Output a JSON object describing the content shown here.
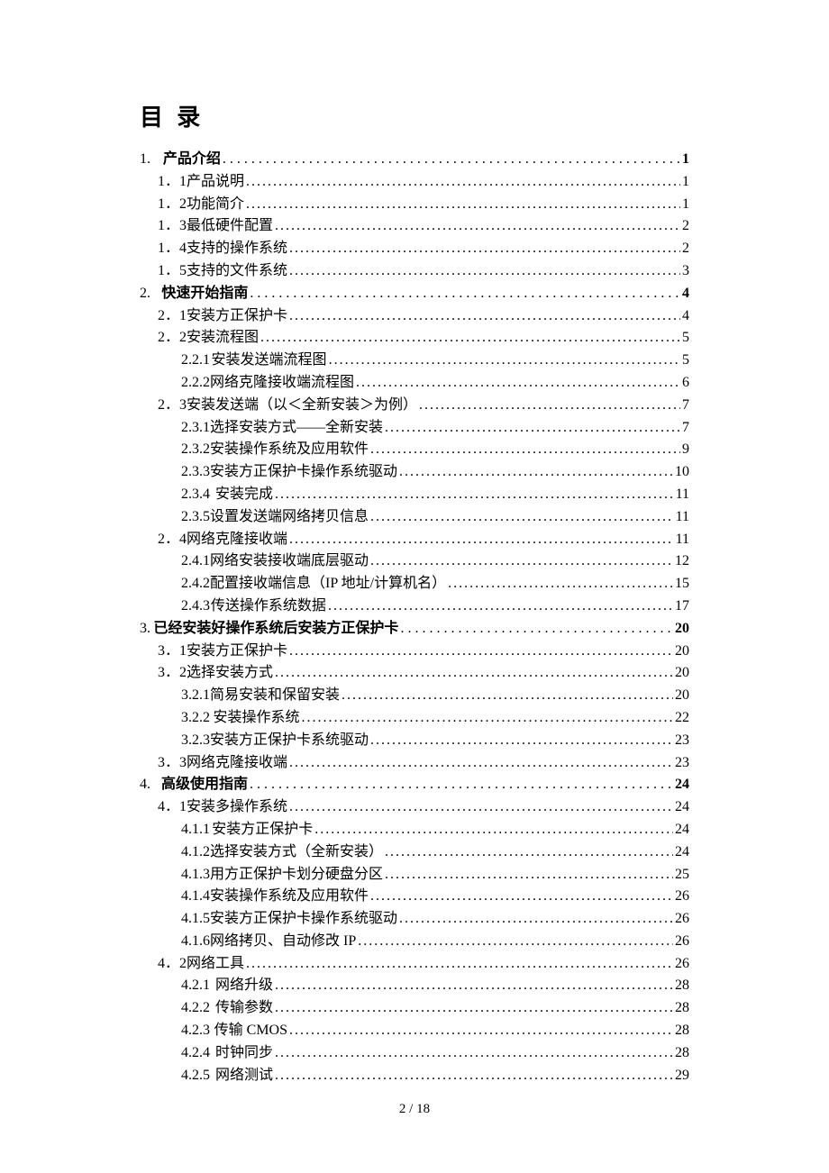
{
  "toc_heading": "目  录",
  "footer": "2  /  18",
  "entries": [
    {
      "level": 1,
      "num": "1.",
      "title": "产品介绍",
      "page": "1",
      "bold": true
    },
    {
      "level": 2,
      "num": "1．1",
      "title": "产品说明",
      "page": "1"
    },
    {
      "level": 2,
      "num": "1．2",
      "title": "功能简介",
      "page": "1"
    },
    {
      "level": 2,
      "num": "1．3",
      "title": "最低硬件配置",
      "page": "2"
    },
    {
      "level": 2,
      "num": "1．4",
      "title": "支持的操作系统",
      "page": "2"
    },
    {
      "level": 2,
      "num": "1．5",
      "title": "支持的文件系统",
      "page": "3"
    },
    {
      "level": 1,
      "num": "2.",
      "title": "快速开始指南",
      "page": "4",
      "bold": true
    },
    {
      "level": 2,
      "num": "2．1",
      "title": "安装方正保护卡",
      "page": "4"
    },
    {
      "level": 2,
      "num": "2．2",
      "title": "安装流程图",
      "page": "5"
    },
    {
      "level": 3,
      "num": "2.2.1",
      "title": "安装发送端流程图",
      "page": "5"
    },
    {
      "level": 3,
      "num": "2.2.2",
      "title": "网络克隆接收端流程图",
      "page": "6"
    },
    {
      "level": 2,
      "num": "2．3",
      "title": "安装发送端（以＜全新安装＞为例）",
      "page": "7"
    },
    {
      "level": 3,
      "num": "2.3.1",
      "title": "选择安装方式——全新安装",
      "page": "7"
    },
    {
      "level": 3,
      "num": "2.3.2",
      "title": "安装操作系统及应用软件",
      "page": "9"
    },
    {
      "level": 3,
      "num": "2.3.3",
      "title": "安装方正保护卡操作系统驱动",
      "page": "10"
    },
    {
      "level": 3,
      "num": "2.3.4",
      "title": "安装完成",
      "page": "11"
    },
    {
      "level": 3,
      "num": "2.3.5",
      "title": "设置发送端网络拷贝信息",
      "page": "11"
    },
    {
      "level": 2,
      "num": "2．4",
      "title": "网络克隆接收端",
      "page": "11"
    },
    {
      "level": 3,
      "num": "2.4.1",
      "title": "网络安装接收端底层驱动",
      "page": "12"
    },
    {
      "level": 3,
      "num": "2.4.2",
      "title": "配置接收端信息（IP 地址/计算机名）",
      "page": "15"
    },
    {
      "level": 3,
      "num": "2.4.3",
      "title": "传送操作系统数据",
      "page": "17"
    },
    {
      "level": 1,
      "num": "3.",
      "title": "已经安装好操作系统后安装方正保护卡",
      "page": "20",
      "bold": true
    },
    {
      "level": 2,
      "num": "3．1",
      "title": "安装方正保护卡",
      "page": "20"
    },
    {
      "level": 2,
      "num": "3．2",
      "title": "选择安装方式",
      "page": "20"
    },
    {
      "level": 3,
      "num": "3.2.1",
      "title": "简易安装和保留安装",
      "page": "20"
    },
    {
      "level": 3,
      "num": "3.2.2",
      "title": "安装操作系统",
      "page": "22"
    },
    {
      "level": 3,
      "num": "3.2.3",
      "title": "安装方正保护卡系统驱动",
      "page": "23"
    },
    {
      "level": 2,
      "num": "3．3",
      "title": "网络克隆接收端",
      "page": "23"
    },
    {
      "level": 1,
      "num": "4.",
      "title": "高级使用指南",
      "page": "24",
      "bold": true
    },
    {
      "level": 2,
      "num": "4．1",
      "title": "安装多操作系统",
      "page": "24"
    },
    {
      "level": 3,
      "num": "4.1.1",
      "title": "安装方正保护卡",
      "page": "24"
    },
    {
      "level": 3,
      "num": "4.1.2",
      "title": "选择安装方式（全新安装）",
      "page": "24"
    },
    {
      "level": 3,
      "num": "4.1.3",
      "title": "用方正保护卡划分硬盘分区",
      "page": "25"
    },
    {
      "level": 3,
      "num": "4.1.4",
      "title": "安装操作系统及应用软件",
      "page": "26"
    },
    {
      "level": 3,
      "num": "4.1.5",
      "title": "安装方正保护卡操作系统驱动",
      "page": "26"
    },
    {
      "level": 3,
      "num": "4.1.6",
      "title": "网络拷贝、自动修改 IP",
      "page": "26"
    },
    {
      "level": 2,
      "num": "4．2",
      "title": "网络工具",
      "page": "26"
    },
    {
      "level": 3,
      "num": "4.2.1",
      "title": "网络升级",
      "page": "28"
    },
    {
      "level": 3,
      "num": "4.2.2",
      "title": "传输参数",
      "page": "28"
    },
    {
      "level": 3,
      "num": "4.2.3",
      "title": "传输 CMOS",
      "page": "28"
    },
    {
      "level": 3,
      "num": "4.2.4",
      "title": "时钟同步",
      "page": "28"
    },
    {
      "level": 3,
      "num": "4.2.5",
      "title": "网络测试",
      "page": "29"
    }
  ]
}
